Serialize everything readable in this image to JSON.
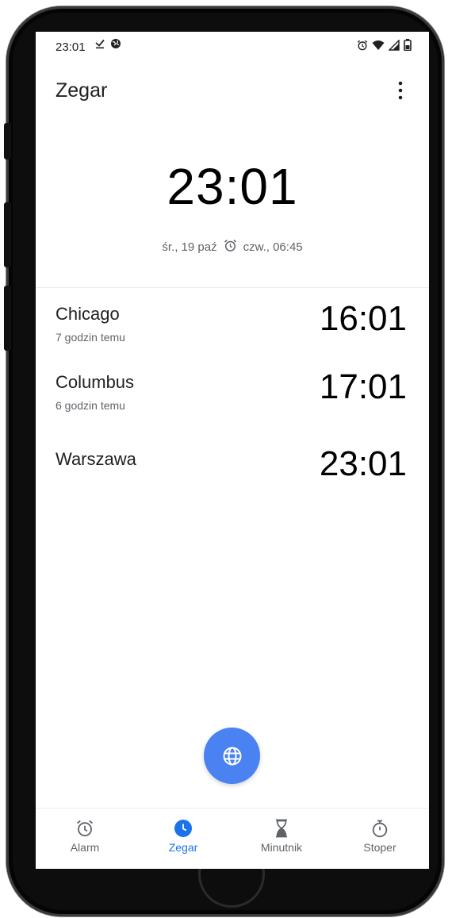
{
  "status_bar": {
    "time": "23:01",
    "left_icons": [
      "download-done-icon",
      "vpn-globe-icon"
    ],
    "right_icons": [
      "alarm-icon",
      "wifi-icon",
      "signal-icon",
      "battery-icon"
    ]
  },
  "app_bar": {
    "title": "Zegar",
    "more_icon": "more-vert-icon"
  },
  "main_clock": {
    "time": "23:01",
    "date": "śr., 19 paź",
    "alarm_icon": "alarm-icon",
    "next_alarm": "czw., 06:45"
  },
  "cities": [
    {
      "name": "Chicago",
      "diff": "7 godzin temu",
      "time": "16:01"
    },
    {
      "name": "Columbus",
      "diff": "6 godzin temu",
      "time": "17:01"
    },
    {
      "name": "Warszawa",
      "diff": "",
      "time": "23:01"
    }
  ],
  "fab": {
    "icon": "globe-icon"
  },
  "bottom_nav": {
    "active": "Zegar",
    "items": [
      {
        "label": "Alarm",
        "icon": "alarm-icon"
      },
      {
        "label": "Zegar",
        "icon": "clock-icon"
      },
      {
        "label": "Minutnik",
        "icon": "hourglass-icon"
      },
      {
        "label": "Stoper",
        "icon": "stopwatch-icon"
      }
    ]
  },
  "colors": {
    "accent": "#1a73e8",
    "fab": "#4a82f1",
    "text_primary": "#202124",
    "text_secondary": "#5f6368"
  }
}
